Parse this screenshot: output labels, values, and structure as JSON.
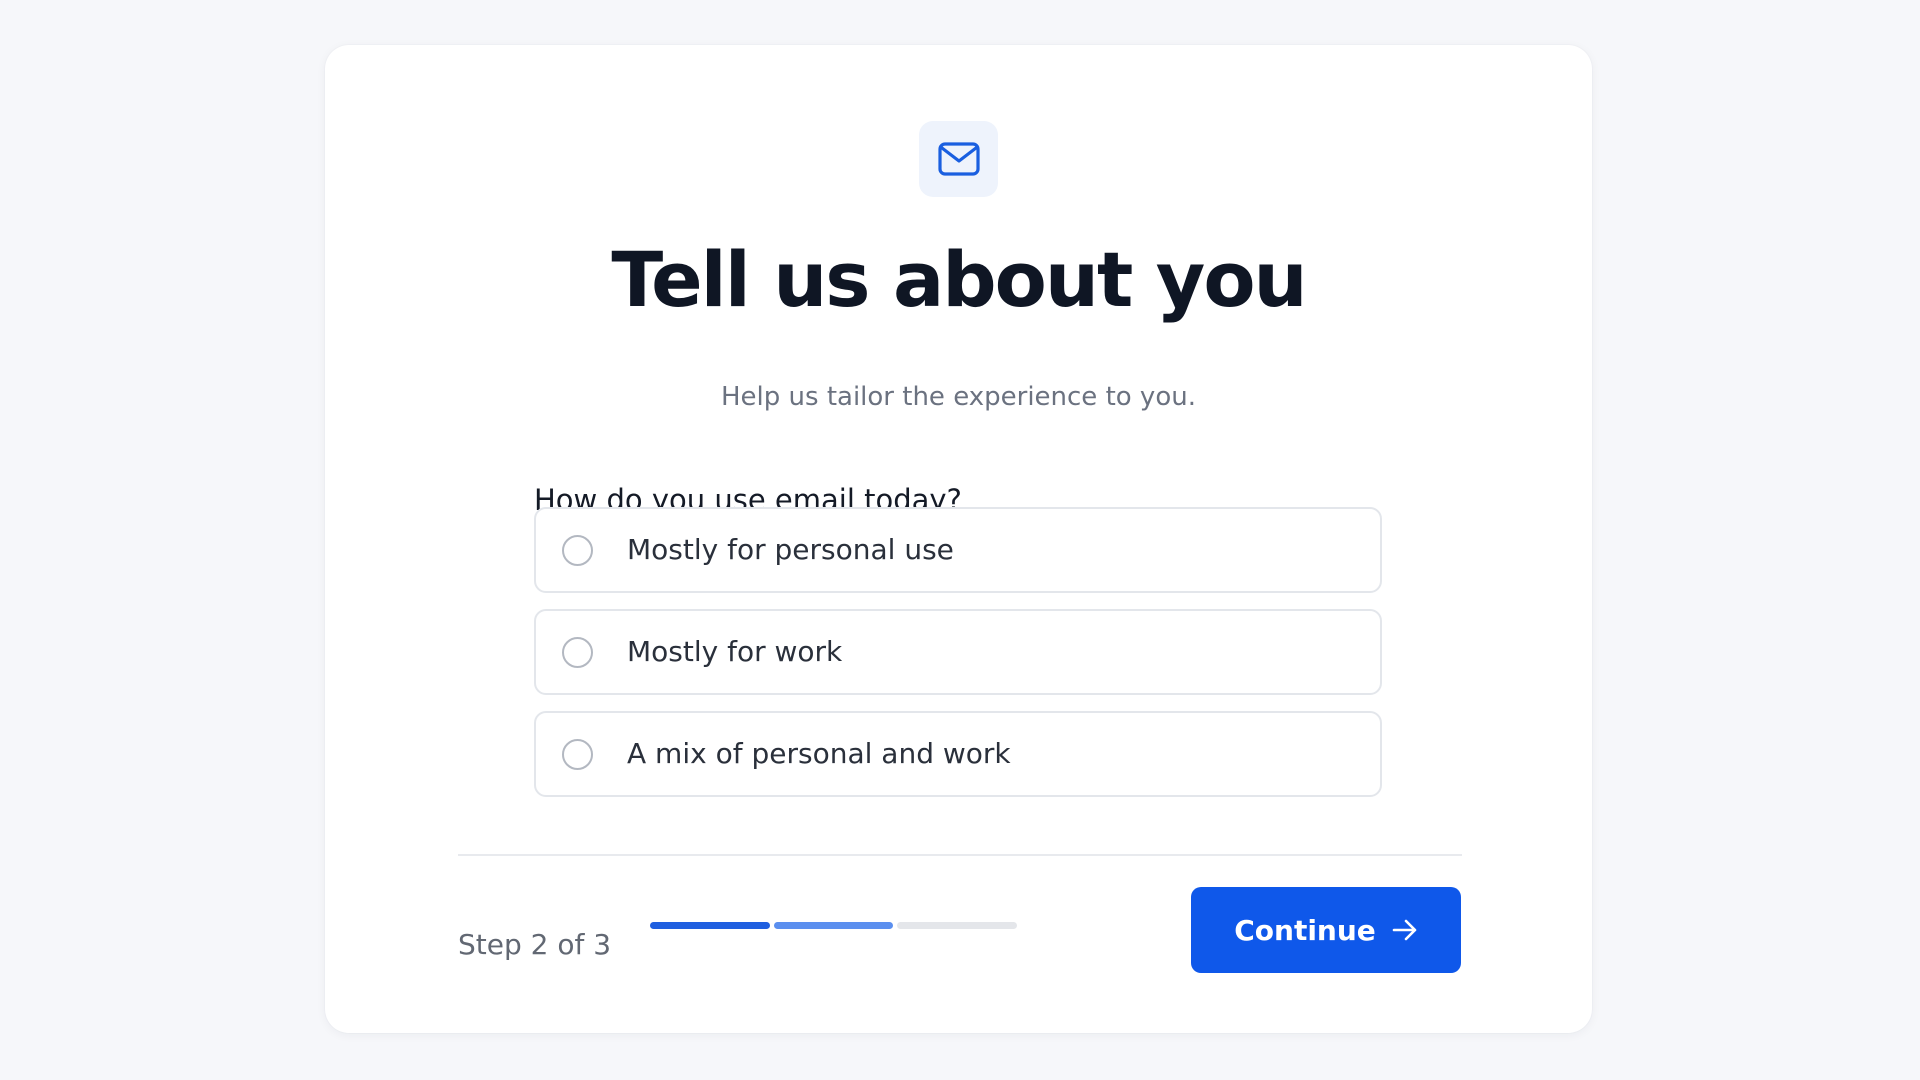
{
  "header": {
    "icon": "mail-icon",
    "title": "Tell us about you",
    "subtitle": "Help us tailor the experience to you."
  },
  "question": {
    "text": "How do you use email today?",
    "options": [
      {
        "label": "Mostly for personal use",
        "selected": false
      },
      {
        "label": "Mostly for work",
        "selected": false
      },
      {
        "label": "A mix of personal and work",
        "selected": false
      }
    ]
  },
  "footer": {
    "step_label": "Step 2 of 3",
    "progress": {
      "current_step": 2,
      "total_steps": 3
    },
    "continue_label": "Continue",
    "continue_icon": "arrow-right-icon"
  },
  "colors": {
    "accent": "#0f58ea",
    "progress_done": "#1f5fe0",
    "progress_current": "#5b8fef",
    "progress_remaining": "#e4e6ea",
    "icon_tile": "#eef3fc"
  }
}
